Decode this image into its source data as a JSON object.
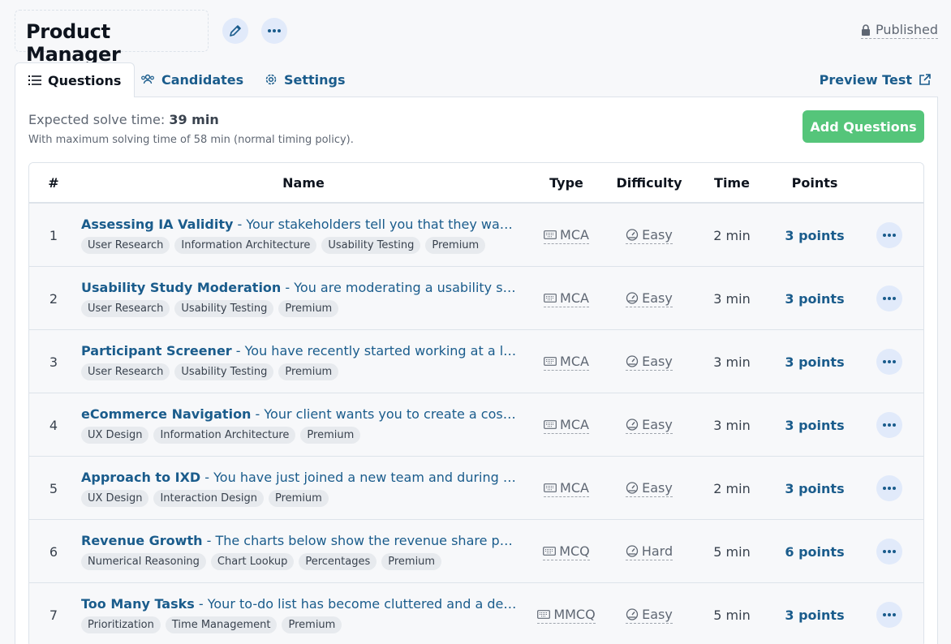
{
  "header": {
    "title": "Product Manager",
    "status": "Published"
  },
  "tabs": [
    {
      "label": "Questions",
      "icon": "list-icon"
    },
    {
      "label": "Candidates",
      "icon": "users-icon"
    },
    {
      "label": "Settings",
      "icon": "gear-icon"
    }
  ],
  "preview_label": "Preview Test",
  "summary": {
    "solve_prefix": "Expected solve time: ",
    "solve_value": "39 min",
    "max_text": "With maximum solving time of 58 min (normal timing policy)."
  },
  "add_questions_label": "Add Questions",
  "columns": {
    "num": "#",
    "name": "Name",
    "type": "Type",
    "difficulty": "Difficulty",
    "time": "Time",
    "points": "Points"
  },
  "rows": [
    {
      "num": "1",
      "title": "Assessing IA Validity",
      "desc": " - Your stakeholders tell you that they want your help to validate...",
      "tags": [
        "User Research",
        "Information Architecture",
        "Usability Testing",
        "Premium"
      ],
      "type": "MCA",
      "difficulty": "Easy",
      "time": "2 min",
      "points": "3 points"
    },
    {
      "num": "2",
      "title": "Usability Study Moderation",
      "desc": " - You are moderating a usability study and...",
      "tags": [
        "User Research",
        "Usability Testing",
        "Premium"
      ],
      "type": "MCA",
      "difficulty": "Easy",
      "time": "3 min",
      "points": "3 points"
    },
    {
      "num": "3",
      "title": "Participant Screener",
      "desc": " - You have recently started working at a large...",
      "tags": [
        "User Research",
        "Usability Testing",
        "Premium"
      ],
      "type": "MCA",
      "difficulty": "Easy",
      "time": "3 min",
      "points": "3 points"
    },
    {
      "num": "4",
      "title": "eCommerce Navigation",
      "desc": " - Your client wants you to create a cosmetics...",
      "tags": [
        "UX Design",
        "Information Architecture",
        "Premium"
      ],
      "type": "MCA",
      "difficulty": "Easy",
      "time": "3 min",
      "points": "3 points"
    },
    {
      "num": "5",
      "title": "Approach to IXD",
      "desc": " - You have just joined a new team and during onboarding...",
      "tags": [
        "UX Design",
        "Interaction Design",
        "Premium"
      ],
      "type": "MCA",
      "difficulty": "Easy",
      "time": "2 min",
      "points": "3 points"
    },
    {
      "num": "6",
      "title": "Revenue Growth",
      "desc": " - The charts below show the revenue share per line...",
      "tags": [
        "Numerical Reasoning",
        "Chart Lookup",
        "Percentages",
        "Premium"
      ],
      "type": "MCQ",
      "difficulty": "Hard",
      "time": "5 min",
      "points": "6 points"
    },
    {
      "num": "7",
      "title": "Too Many Tasks",
      "desc": " - Your to-do list has become cluttered and a deadline...",
      "tags": [
        "Prioritization",
        "Time Management",
        "Premium"
      ],
      "type": "MMCQ",
      "difficulty": "Easy",
      "time": "5 min",
      "points": "3 points"
    }
  ]
}
